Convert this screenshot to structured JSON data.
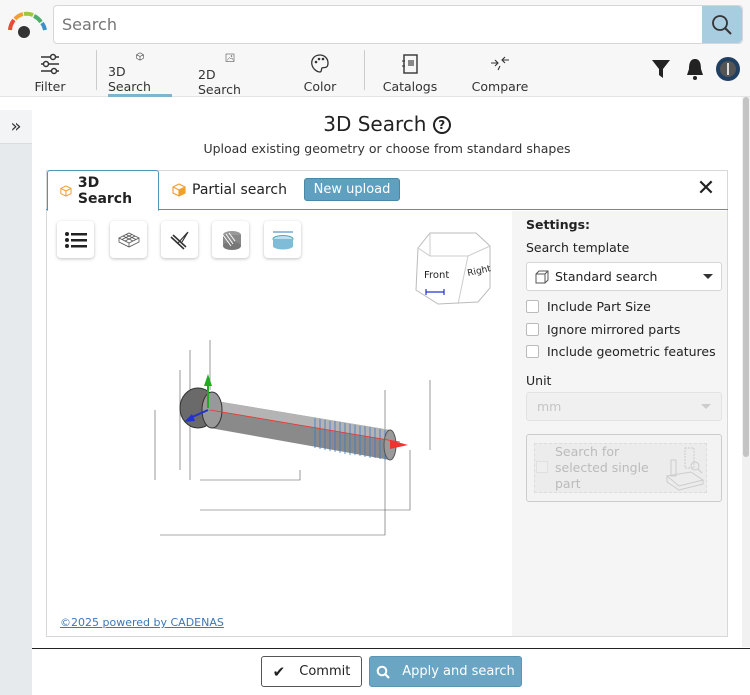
{
  "header": {
    "search_placeholder": "Search"
  },
  "nav": {
    "items": [
      {
        "label": "Filter"
      },
      {
        "label": "3D Search",
        "active": true
      },
      {
        "label": "2D Search"
      },
      {
        "label": "Color"
      },
      {
        "label": "Catalogs"
      },
      {
        "label": "Compare"
      }
    ]
  },
  "main": {
    "title": "3D Search",
    "subtitle": "Upload existing geometry or choose from standard shapes"
  },
  "tabs": [
    {
      "label": "3D Search"
    },
    {
      "label": "Partial search"
    }
  ],
  "new_upload_label": "New upload",
  "viewcube": {
    "front": "Front",
    "right": "Right"
  },
  "settings": {
    "heading": "Settings:",
    "template_label": "Search template",
    "template_value": "Standard search",
    "checkboxes": [
      {
        "label": "Include Part Size",
        "checked": false
      },
      {
        "label": "Ignore mirrored parts",
        "checked": false
      },
      {
        "label": "Include geometric features",
        "checked": false
      }
    ],
    "unit_label": "Unit",
    "unit_value": "mm",
    "single_part_label": "Search for selected single part"
  },
  "copyright": "©2025 powered by CADENAS",
  "footer": {
    "commit": "Commit",
    "apply": "Apply and search"
  },
  "colors": {
    "accent": "#6aa6c4",
    "search_button": "#a8cde0",
    "tab_border": "#4e95bb"
  }
}
